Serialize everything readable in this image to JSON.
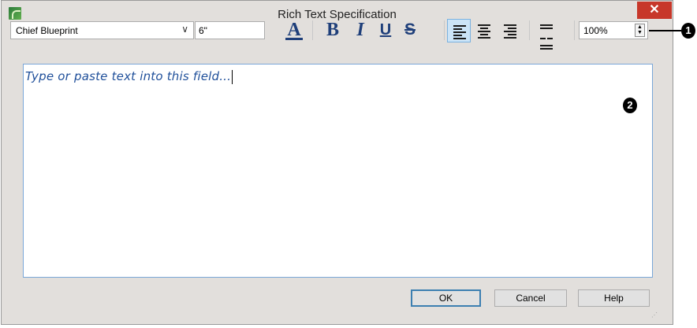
{
  "window": {
    "title": "Rich Text Specification",
    "close": "✕"
  },
  "toolbar": {
    "font": "Chief Blueprint",
    "size": "6\"",
    "zoom": "100%",
    "buttons": {
      "color": "A",
      "bold": "B",
      "italic": "I",
      "underline": "U",
      "strike": "S"
    }
  },
  "editor": {
    "placeholder": "Type or paste text into this field..."
  },
  "callouts": {
    "one": "1",
    "two": "2"
  },
  "buttons": {
    "ok": "OK",
    "cancel": "Cancel",
    "help": "Help"
  }
}
